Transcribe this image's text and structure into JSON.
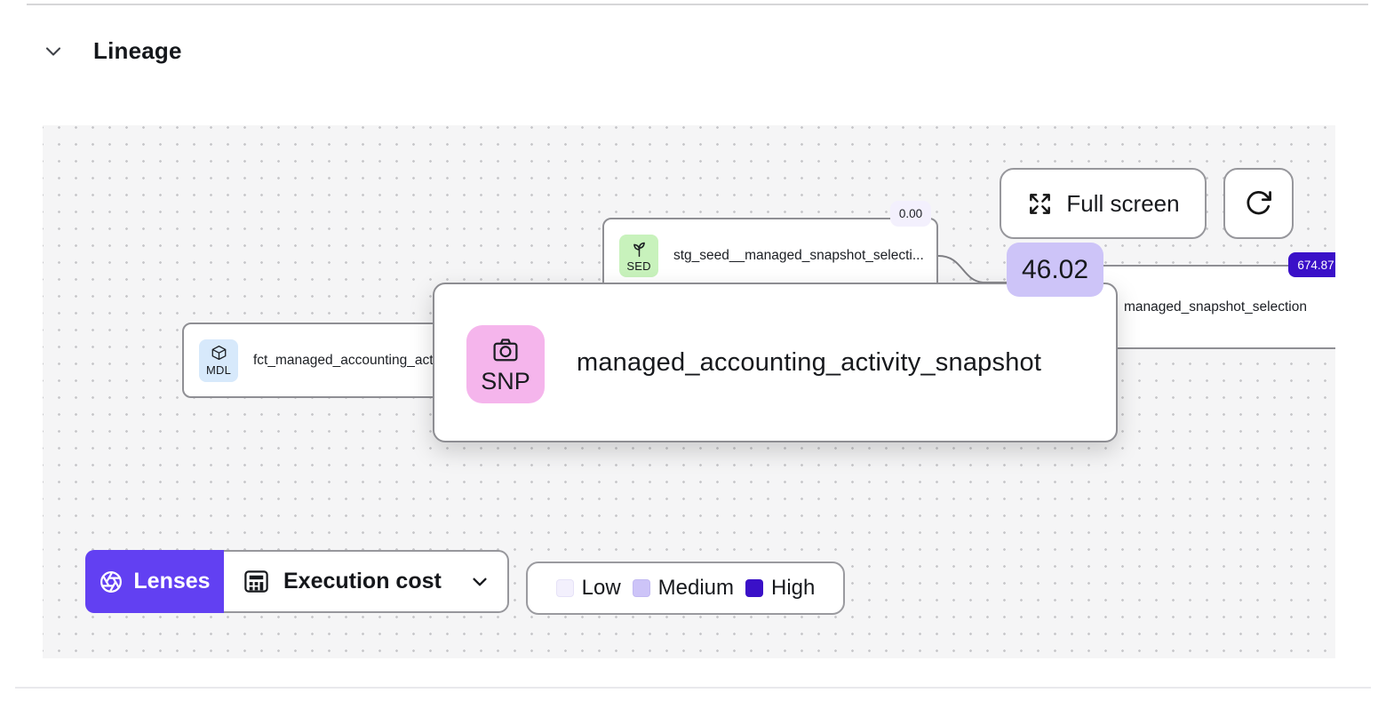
{
  "header": {
    "title": "Lineage"
  },
  "lineage": {
    "controls": {
      "full_screen": "Full screen"
    },
    "nodes": {
      "seed": {
        "type_badge": "SED",
        "type_color": "#c8f2bc",
        "label": "stg_seed__managed_snapshot_selecti...",
        "cost_badge": "0.00",
        "cost_color": "#f3f0fd"
      },
      "model": {
        "type_badge": "MDL",
        "type_color": "#d7e9fb",
        "label": "fct_managed_accounting_act"
      },
      "selection": {
        "label": "managed_snapshot_selection",
        "cost_badge": "674.87",
        "cost_color": "#3a10c8"
      }
    },
    "hover_card": {
      "type_badge": "SNP",
      "type_color": "#f5b5ec",
      "label": "managed_accounting_activity_snapshot",
      "cost_badge": "46.02",
      "cost_color": "#cdc4f8"
    }
  },
  "toolbar": {
    "lenses_label": "Lenses",
    "lenses_color": "#6240f2",
    "selected_lens": "Execution cost"
  },
  "legend": {
    "items": [
      {
        "label": "Low",
        "color": "#f3f0fd"
      },
      {
        "label": "Medium",
        "color": "#cdc4f8"
      },
      {
        "label": "High",
        "color": "#3a10c8"
      }
    ]
  }
}
